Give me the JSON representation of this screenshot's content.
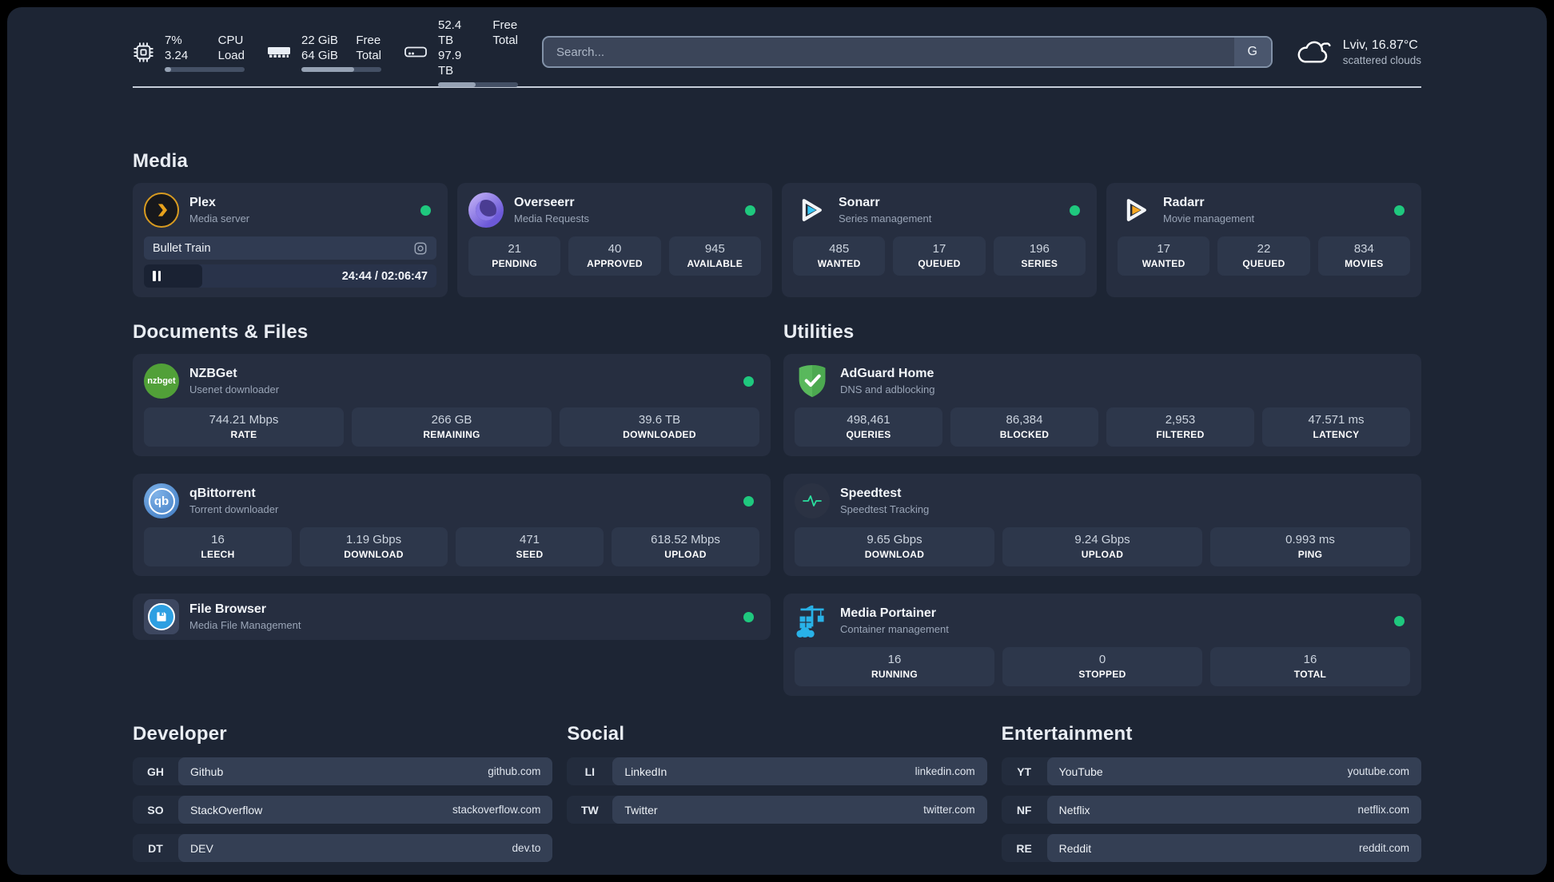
{
  "header": {
    "system_stats": [
      {
        "icon": "cpu-icon",
        "col1_top": "7%",
        "col1_bottom": "3.24",
        "col2_top": "CPU",
        "col2_bottom": "Load",
        "progress_pct": 8
      },
      {
        "icon": "ram-icon",
        "col1_top": "22 GiB",
        "col1_bottom": "64 GiB",
        "col2_top": "Free",
        "col2_bottom": "Total",
        "progress_pct": 66
      },
      {
        "icon": "disk-icon",
        "col1_top": "52.4 TB",
        "col1_bottom": "97.9 TB",
        "col2_top": "Free",
        "col2_bottom": "Total",
        "progress_pct": 47
      }
    ],
    "search": {
      "placeholder": "Search...",
      "engine_button": "G"
    },
    "weather": {
      "location": "Lviv, 16.87°C",
      "condition": "scattered clouds"
    }
  },
  "colors": {
    "status_online": "#1fc87e",
    "plex_accent": "#e8a21c",
    "sonarr_accent": "#38c6f4",
    "radarr_accent": "#f7a823",
    "adguard_accent": "#59b85c",
    "portainer_accent": "#29b2e8",
    "speedtest_accent": "#2adf9f"
  },
  "sections": {
    "media": {
      "title": "Media",
      "plex": {
        "name": "Plex",
        "subtitle": "Media server",
        "now_playing": "Bullet Train",
        "time_display": "24:44 / 02:06:47",
        "progress_pct": 20
      },
      "overseerr": {
        "name": "Overseerr",
        "subtitle": "Media Requests",
        "stats": [
          {
            "value": "21",
            "label": "PENDING"
          },
          {
            "value": "40",
            "label": "APPROVED"
          },
          {
            "value": "945",
            "label": "AVAILABLE"
          }
        ]
      },
      "sonarr": {
        "name": "Sonarr",
        "subtitle": "Series management",
        "stats": [
          {
            "value": "485",
            "label": "WANTED"
          },
          {
            "value": "17",
            "label": "QUEUED"
          },
          {
            "value": "196",
            "label": "SERIES"
          }
        ]
      },
      "radarr": {
        "name": "Radarr",
        "subtitle": "Movie management",
        "stats": [
          {
            "value": "17",
            "label": "WANTED"
          },
          {
            "value": "22",
            "label": "QUEUED"
          },
          {
            "value": "834",
            "label": "MOVIES"
          }
        ]
      }
    },
    "documents": {
      "title": "Documents & Files",
      "nzbget": {
        "name": "NZBGet",
        "subtitle": "Usenet downloader",
        "stats": [
          {
            "value": "744.21 Mbps",
            "label": "RATE"
          },
          {
            "value": "266 GB",
            "label": "REMAINING"
          },
          {
            "value": "39.6 TB",
            "label": "DOWNLOADED"
          }
        ]
      },
      "qbittorrent": {
        "name": "qBittorrent",
        "subtitle": "Torrent downloader",
        "stats": [
          {
            "value": "16",
            "label": "LEECH"
          },
          {
            "value": "1.19 Gbps",
            "label": "DOWNLOAD"
          },
          {
            "value": "471",
            "label": "SEED"
          },
          {
            "value": "618.52 Mbps",
            "label": "UPLOAD"
          }
        ]
      },
      "filebrowser": {
        "name": "File Browser",
        "subtitle": "Media File Management"
      }
    },
    "utilities": {
      "title": "Utilities",
      "adguard": {
        "name": "AdGuard Home",
        "subtitle": "DNS and adblocking",
        "stats": [
          {
            "value": "498,461",
            "label": "QUERIES"
          },
          {
            "value": "86,384",
            "label": "BLOCKED"
          },
          {
            "value": "2,953",
            "label": "FILTERED"
          },
          {
            "value": "47.571 ms",
            "label": "LATENCY"
          }
        ]
      },
      "speedtest": {
        "name": "Speedtest",
        "subtitle": "Speedtest Tracking",
        "stats": [
          {
            "value": "9.65 Gbps",
            "label": "DOWNLOAD"
          },
          {
            "value": "9.24 Gbps",
            "label": "UPLOAD"
          },
          {
            "value": "0.993 ms",
            "label": "PING"
          }
        ]
      },
      "portainer": {
        "name": "Media Portainer",
        "subtitle": "Container management",
        "stats": [
          {
            "value": "16",
            "label": "RUNNING"
          },
          {
            "value": "0",
            "label": "STOPPED"
          },
          {
            "value": "16",
            "label": "TOTAL"
          }
        ]
      }
    }
  },
  "links": {
    "developer": {
      "title": "Developer",
      "links": [
        {
          "tag": "GH",
          "name": "Github",
          "url": "github.com"
        },
        {
          "tag": "SO",
          "name": "StackOverflow",
          "url": "stackoverflow.com"
        },
        {
          "tag": "DT",
          "name": "DEV",
          "url": "dev.to"
        }
      ]
    },
    "social": {
      "title": "Social",
      "links": [
        {
          "tag": "LI",
          "name": "LinkedIn",
          "url": "linkedin.com"
        },
        {
          "tag": "TW",
          "name": "Twitter",
          "url": "twitter.com"
        }
      ]
    },
    "entertainment": {
      "title": "Entertainment",
      "links": [
        {
          "tag": "YT",
          "name": "YouTube",
          "url": "youtube.com"
        },
        {
          "tag": "NF",
          "name": "Netflix",
          "url": "netflix.com"
        },
        {
          "tag": "RE",
          "name": "Reddit",
          "url": "reddit.com"
        }
      ]
    }
  }
}
